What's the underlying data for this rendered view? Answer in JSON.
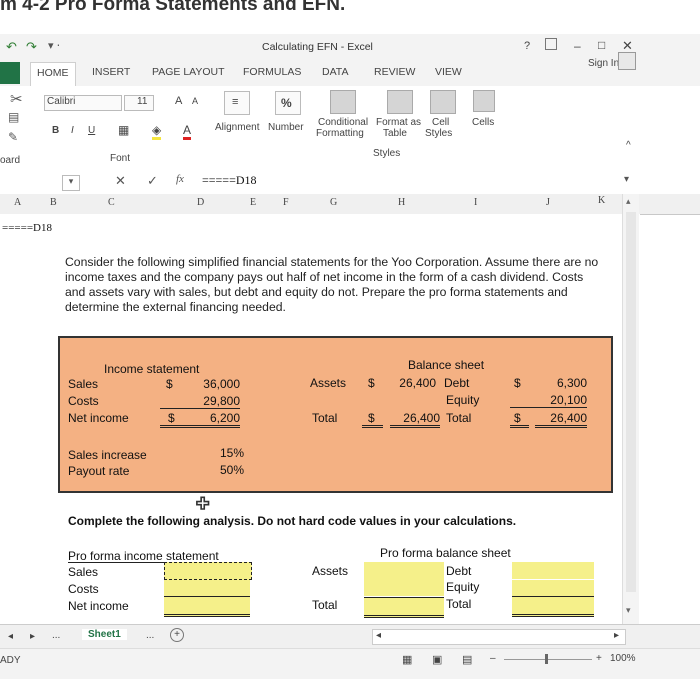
{
  "page_heading": "m 4-2 Pro Forma Statements and EFN.",
  "window": {
    "title": "Calculating EFN - Excel",
    "help": "?",
    "min": "–",
    "max": "□",
    "close": "✕",
    "sign_in": "Sign In"
  },
  "tabs": [
    "HOME",
    "INSERT",
    "PAGE LAYOUT",
    "FORMULAS",
    "DATA",
    "REVIEW",
    "VIEW"
  ],
  "ribbon": {
    "font_name": "Calibri",
    "font_size": "11",
    "bold": "B",
    "italic": "I",
    "underline": "U",
    "alignment": "Alignment",
    "number": "Number",
    "percent": "%",
    "conditional": "Conditional",
    "formatting": "Formatting",
    "format_as": "Format as",
    "table": "Table",
    "cell": "Cell",
    "styles": "Styles",
    "cells": "Cells",
    "styles_group": "Styles",
    "font_group": "Font",
    "clipboard_group": "oard"
  },
  "formula_bar": {
    "cancel": "✕",
    "enter": "✓",
    "fx": "fx",
    "content": "=====D18"
  },
  "columns": [
    "A",
    "B",
    "C",
    "D",
    "E",
    "F",
    "G",
    "H",
    "I",
    "J",
    "K"
  ],
  "cell_b1": "=====D18",
  "description": "Consider the following simplified financial statements for the Yoo Corporation. Assume there are no income taxes and the company pays out half of net income in the form of a cash dividend. Costs and assets vary with sales, but debt and equity do not. Prepare the pro forma statements and determine the external financing needed.",
  "income": {
    "title": "Income statement",
    "sales_label": "Sales",
    "sales_cur": "$",
    "sales": "36,000",
    "costs_label": "Costs",
    "costs": "29,800",
    "ni_label": "Net income",
    "ni_cur": "$",
    "ni": "6,200"
  },
  "balance": {
    "title": "Balance sheet",
    "assets_label": "Assets",
    "assets_cur": "$",
    "assets": "26,400",
    "debt_label": "Debt",
    "debt_cur": "$",
    "debt": "6,300",
    "equity_label": "Equity",
    "equity": "20,100",
    "total_label": "Total",
    "total_cur": "$",
    "total": "26,400",
    "total2_label": "Total",
    "total2_cur": "$",
    "total2": "26,400"
  },
  "assumptions": {
    "sales_inc_label": "Sales increase",
    "sales_inc": "15%",
    "payout_label": "Payout rate",
    "payout": "50%"
  },
  "instruction": "Complete the following analysis. Do not hard code values in your calculations.",
  "pf_income": {
    "title": "Pro forma income statement",
    "sales": "Sales",
    "costs": "Costs",
    "ni": "Net income"
  },
  "pf_balance": {
    "title": "Pro forma balance sheet",
    "assets": "Assets",
    "debt": "Debt",
    "equity": "Equity",
    "total": "Total",
    "total2": "Total"
  },
  "sheet_tab": "Sheet1",
  "more": "...",
  "add": "+",
  "status": {
    "ready": "ADY",
    "zoom": "100%"
  }
}
